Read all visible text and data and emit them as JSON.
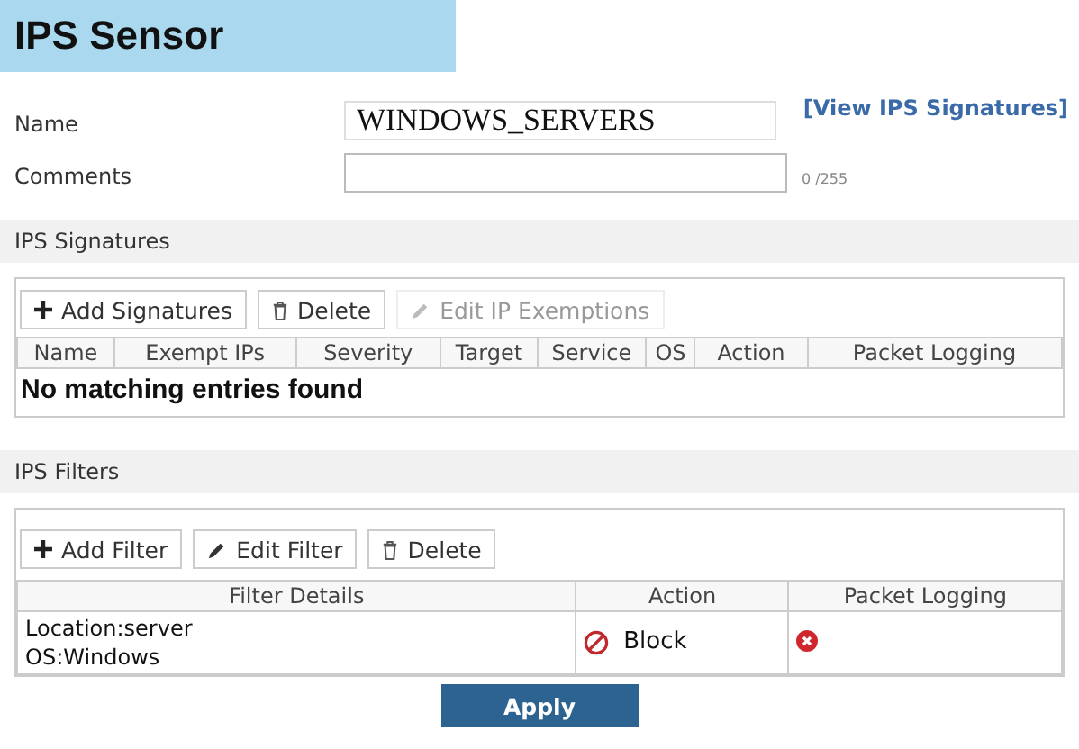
{
  "title": "IPS Sensor",
  "form": {
    "name_label": "Name",
    "name_value": "WINDOWS_SERVERS",
    "comments_label": "Comments",
    "comments_count": "0 /255",
    "view_link": "[View IPS Signatures]"
  },
  "signatures": {
    "heading": "IPS Signatures",
    "buttons": [
      {
        "label": "Add Signatures",
        "kind": "add",
        "disabled": false
      },
      {
        "label": "Delete",
        "kind": "delete",
        "disabled": false
      },
      {
        "label": "Edit IP Exemptions",
        "kind": "edit",
        "disabled": true
      }
    ],
    "columns": [
      "Name",
      "Exempt IPs",
      "Severity",
      "Target",
      "Service",
      "OS",
      "Action",
      "Packet Logging"
    ],
    "empty": "No matching entries found"
  },
  "filters": {
    "heading": "IPS Filters",
    "buttons": [
      {
        "label": "Add Filter",
        "kind": "add",
        "disabled": false
      },
      {
        "label": "Edit Filter",
        "kind": "edit",
        "disabled": false
      },
      {
        "label": "Delete",
        "kind": "delete",
        "disabled": false
      }
    ],
    "columns": [
      "Filter Details",
      "Action",
      "Packet Logging"
    ],
    "rows": [
      {
        "details": [
          "Location:server",
          "OS:Windows"
        ],
        "action": "Block",
        "packet_logging": false
      }
    ]
  },
  "apply": "Apply"
}
